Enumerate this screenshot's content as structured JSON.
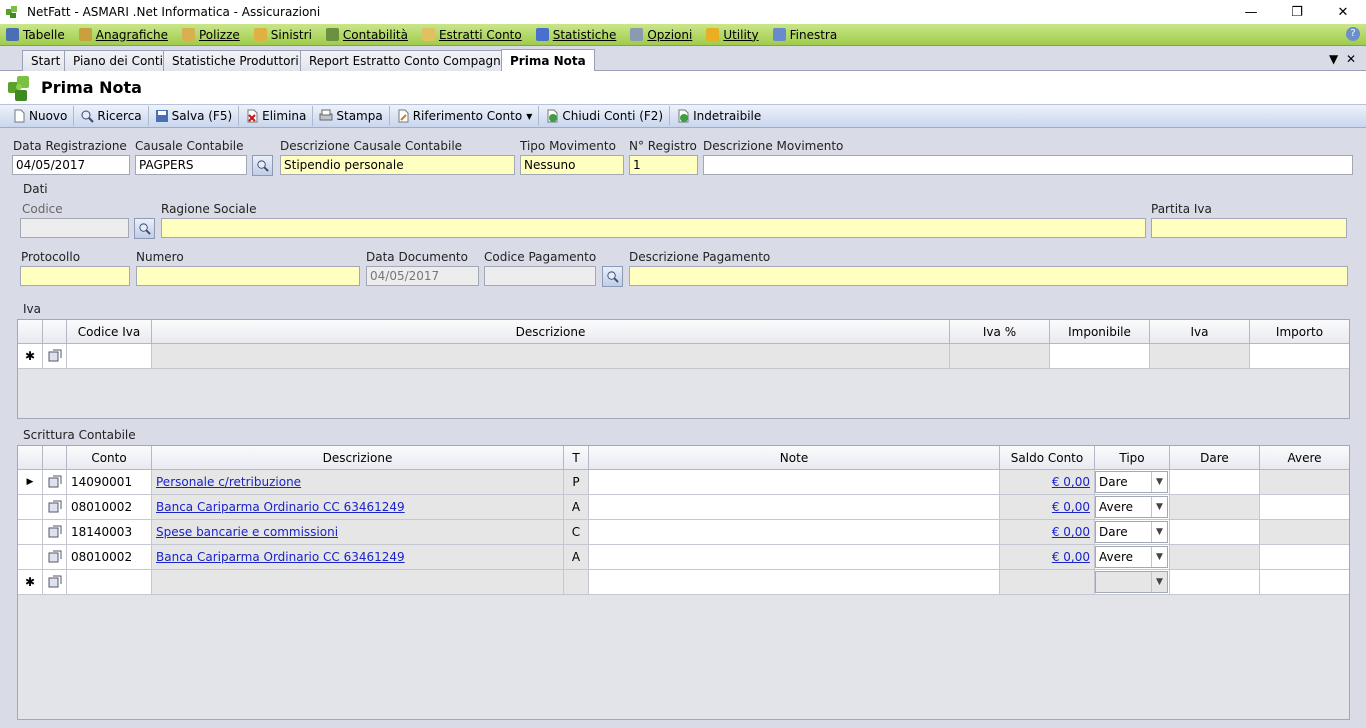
{
  "window": {
    "title": "NetFatt - ASMARI .Net Informatica - Assicurazioni",
    "min": "—",
    "max": "❐",
    "close": "✕"
  },
  "menu": [
    {
      "label": "Tabelle",
      "color": "#4a6fb5"
    },
    {
      "label": "Anagrafiche",
      "color": "#c8a040"
    },
    {
      "label": "Polizze",
      "color": "#d8b050"
    },
    {
      "label": "Sinistri",
      "color": "#e0b040"
    },
    {
      "label": "Contabilità",
      "color": "#6a9040"
    },
    {
      "label": "Estratti Conto",
      "color": "#e0c060"
    },
    {
      "label": "Statistiche",
      "color": "#4a6fd0"
    },
    {
      "label": "Opzioni",
      "color": "#8a9ab0"
    },
    {
      "label": "Utility",
      "color": "#e8b020"
    },
    {
      "label": "Finestra",
      "color": "#6a8ad0"
    }
  ],
  "help": "?",
  "tabs": [
    "Start",
    "Piano dei Conti",
    "Statistiche Produttori",
    "Report Estratto Conto Compagnie",
    "Prima Nota"
  ],
  "page_title": "Prima Nota",
  "toolbar": {
    "nuovo": "Nuovo",
    "ricerca": "Ricerca",
    "salva": "Salva (F5)",
    "elimina": "Elimina",
    "stampa": "Stampa",
    "riferimento": "Riferimento Conto",
    "chiudi": "Chiudi Conti (F2)",
    "indetraibile": "Indetraibile"
  },
  "form": {
    "data_registrazione_label": "Data Registrazione",
    "data_registrazione": "04/05/2017",
    "causale_label": "Causale Contabile",
    "causale": "PAGPERS",
    "desc_causale_label": "Descrizione Causale Contabile",
    "desc_causale": "Stipendio personale",
    "tipo_mov_label": "Tipo Movimento",
    "tipo_mov": "Nessuno",
    "n_registro_label": "N° Registro",
    "n_registro": "1",
    "desc_mov_label": "Descrizione Movimento",
    "desc_mov": ""
  },
  "dati": {
    "section": "Dati",
    "codice_label": "Codice",
    "ragione_label": "Ragione Sociale",
    "piva_label": "Partita Iva",
    "protocollo_label": "Protocollo",
    "numero_label": "Numero",
    "data_doc_label": "Data Documento",
    "data_doc": "04/05/2017",
    "cod_pag_label": "Codice Pagamento",
    "desc_pag_label": "Descrizione Pagamento"
  },
  "iva": {
    "section": "Iva",
    "headers": [
      "Codice Iva",
      "Descrizione",
      "Iva %",
      "Imponibile",
      "Iva",
      "Importo"
    ],
    "new_row_marker": "✱"
  },
  "scrittura": {
    "section": "Scrittura Contabile",
    "headers": [
      "Conto",
      "Descrizione",
      "T",
      "Note",
      "Saldo Conto",
      "Tipo",
      "Dare",
      "Avere"
    ],
    "rows": [
      {
        "conto": "14090001",
        "descrizione": "Personale c/retribuzione",
        "t": "P",
        "note": "",
        "saldo": "€ 0,00",
        "tipo": "Dare"
      },
      {
        "conto": "08010002",
        "descrizione": "Banca Cariparma Ordinario CC 63461249",
        "t": "A",
        "note": "",
        "saldo": "€ 0,00",
        "tipo": "Avere"
      },
      {
        "conto": "18140003",
        "descrizione": "Spese bancarie e commissioni",
        "t": "C",
        "note": "",
        "saldo": "€ 0,00",
        "tipo": "Dare"
      },
      {
        "conto": "08010002",
        "descrizione": "Banca Cariparma Ordinario CC 63461249",
        "t": "A",
        "note": "",
        "saldo": "€ 0,00",
        "tipo": "Avere"
      }
    ],
    "current_row_marker": "▶",
    "new_row_marker": "✱"
  }
}
